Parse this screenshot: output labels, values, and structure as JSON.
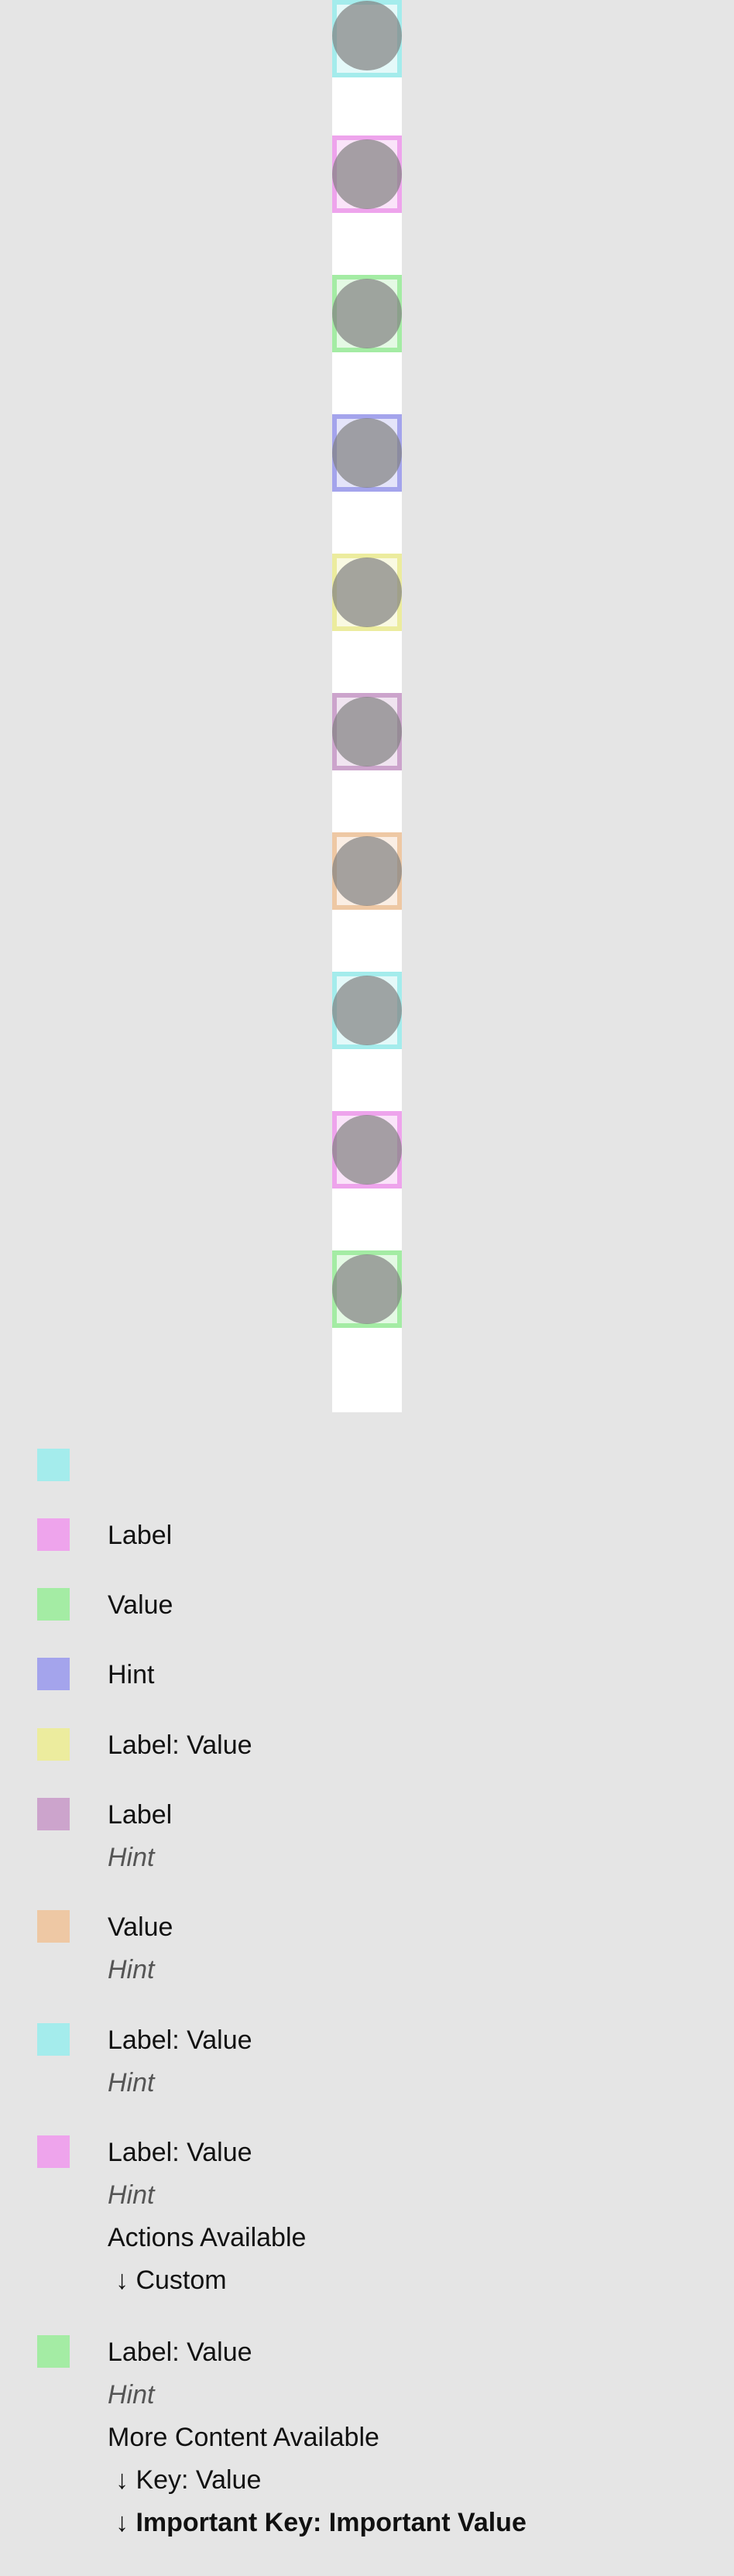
{
  "colors": {
    "background": "#e5e5e5",
    "strip": "#ffffff",
    "circle": "#808080",
    "swatches": [
      "#a4ecec",
      "#eea4ec",
      "#a4eca4",
      "#a4a4ec",
      "#ecec9e",
      "#cca4cc",
      "#eec8a4",
      "#a4ecec",
      "#eea4ec",
      "#a4eca4"
    ]
  },
  "elements": [
    {
      "label": "",
      "value": "",
      "hint": "",
      "actions": [],
      "content": []
    },
    {
      "text": "Label"
    },
    {
      "text": "Value"
    },
    {
      "text": "Hint"
    },
    {
      "text": "Label: Value"
    },
    {
      "text": "Label",
      "hint": "Hint"
    },
    {
      "text": "Value",
      "hint": "Hint"
    },
    {
      "text": "Label: Value",
      "hint": "Hint"
    },
    {
      "text": "Label: Value",
      "hint": "Hint",
      "actions_header": "Actions Available",
      "actions": [
        "↓ Custom"
      ]
    },
    {
      "text": "Label: Value",
      "hint": "Hint",
      "content_header": "More Content Available",
      "content": [
        "↓ Key: Value",
        "↓ Important Key: Important Value"
      ]
    }
  ]
}
